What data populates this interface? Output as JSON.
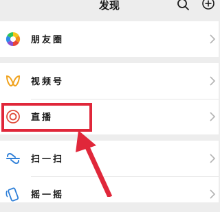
{
  "header": {
    "title": "发现",
    "search_icon": "search-icon",
    "add_icon": "plus-circle-icon"
  },
  "menu": {
    "moments": {
      "label": "朋友圈",
      "icon": "moments-aperture-icon"
    },
    "channels": {
      "label": "视频号",
      "icon": "channels-butterfly-icon"
    },
    "live": {
      "label": "直播",
      "icon": "live-target-icon"
    },
    "scan": {
      "label": "扫一扫",
      "icon": "scan-icon"
    },
    "shake": {
      "label": "摇一摇",
      "icon": "shake-icon"
    }
  },
  "annotation": {
    "color": "#e0273a",
    "target": "live"
  },
  "colors": {
    "background": "#ededed",
    "cell": "#ffffff",
    "live": "#e04b3a",
    "channels": "#f0a21d"
  }
}
